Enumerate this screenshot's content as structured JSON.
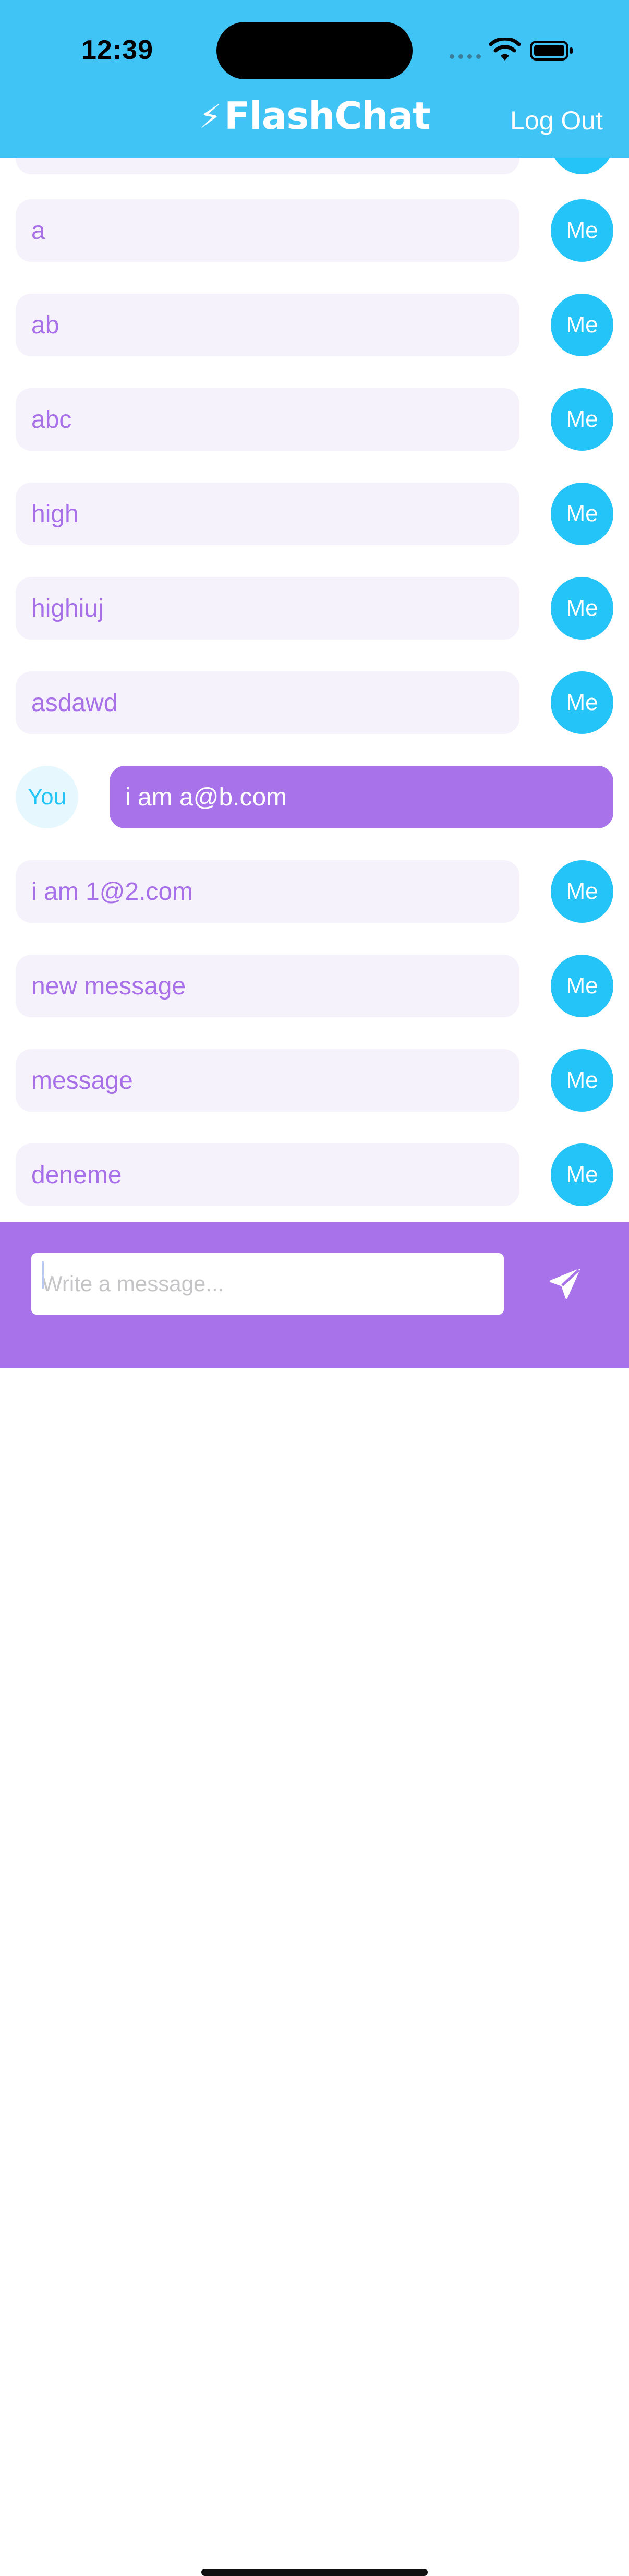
{
  "status_bar": {
    "time": "12:39"
  },
  "header": {
    "bolt": "⚡",
    "title": "FlashChat",
    "logout_label": "Log Out"
  },
  "messages": [
    {
      "text": "",
      "sender": "Me"
    },
    {
      "text": "a",
      "sender": "Me"
    },
    {
      "text": "ab",
      "sender": "Me"
    },
    {
      "text": "abc",
      "sender": "Me"
    },
    {
      "text": "high",
      "sender": "Me"
    },
    {
      "text": "highiuj",
      "sender": "Me"
    },
    {
      "text": "asdawd",
      "sender": "Me"
    },
    {
      "text": "i am a@b.com",
      "sender": "You"
    },
    {
      "text": "i am 1@2.com",
      "sender": "Me"
    },
    {
      "text": "new message",
      "sender": "Me"
    },
    {
      "text": "message",
      "sender": "Me"
    },
    {
      "text": "deneme",
      "sender": "Me"
    }
  ],
  "composer": {
    "placeholder": "Write a message...",
    "value": ""
  },
  "icons": {
    "send": "paper-plane-icon",
    "wifi": "wifi-icon",
    "battery": "battery-icon",
    "signal": "cellular-signal-icon"
  },
  "colors": {
    "header": "#40c4f5",
    "accent_purple": "#a872ea",
    "me_avatar": "#25c4f8",
    "bubble_mine": "#f6f2fb"
  }
}
